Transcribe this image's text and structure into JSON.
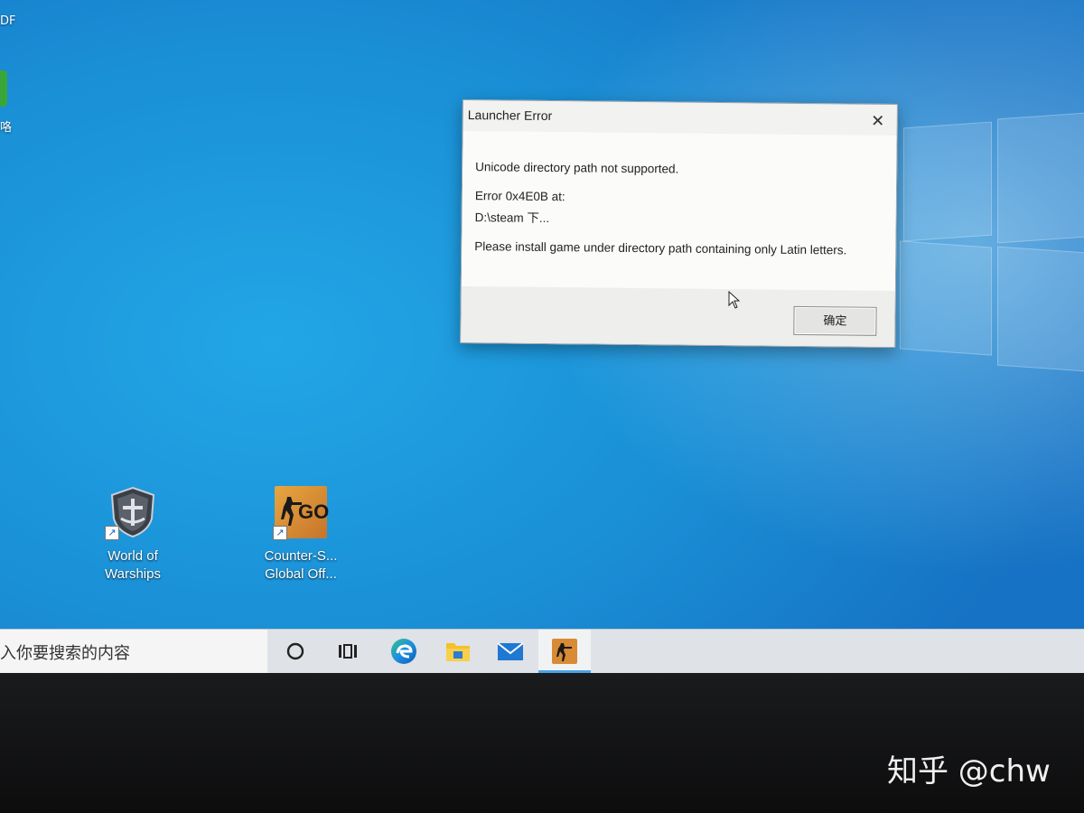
{
  "desktop": {
    "edge_labels": [
      "DF",
      "咯"
    ],
    "icons": [
      {
        "label_line1": "World of",
        "label_line2": "Warships",
        "icon": "world-of-warships-icon"
      },
      {
        "label_line1": "Counter-S...",
        "label_line2": "Global Off...",
        "icon": "csgo-icon",
        "badge": "GO"
      }
    ]
  },
  "dialog": {
    "title": "Launcher Error",
    "close_glyph": "✕",
    "line1": "Unicode directory path not supported.",
    "line2": "Error 0x4E0B at:",
    "line3": "D:\\steam 下...",
    "line4": "Please install game under directory path containing only Latin letters.",
    "ok_label": "确定"
  },
  "taskbar": {
    "search_placeholder": "入你要搜索的内容",
    "buttons": [
      "cortana-icon",
      "task-view-icon",
      "edge-icon",
      "file-explorer-icon",
      "mail-icon",
      "csgo-taskbar-icon"
    ],
    "active_index": 5
  },
  "watermark": "知乎 @chw",
  "colors": {
    "desktop_blue": "#1a8fd6",
    "taskbar_bg": "#dfe2e6",
    "active_indicator": "#4aa3e6"
  }
}
